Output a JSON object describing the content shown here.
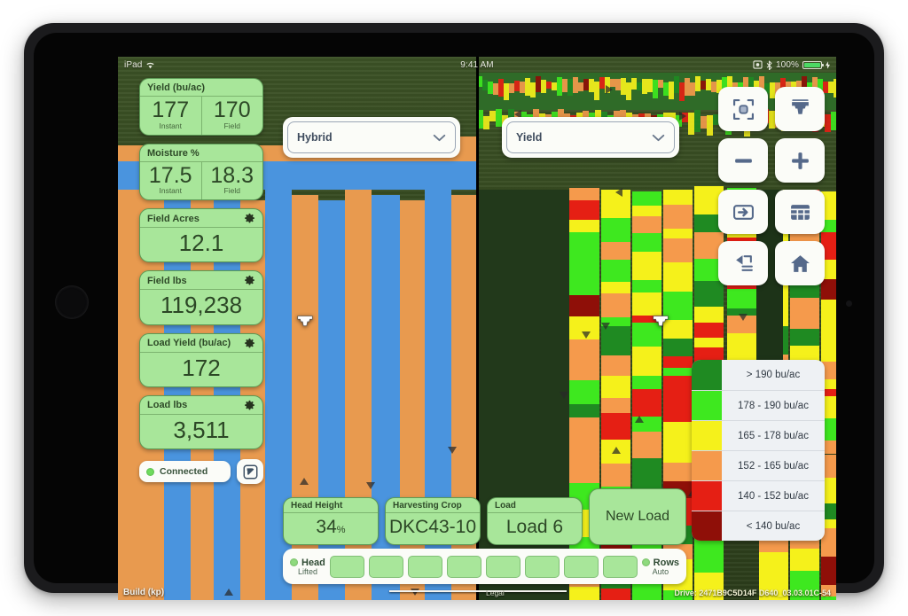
{
  "status_bar": {
    "carrier": "iPad",
    "wifi_icon": "wifi-icon",
    "time": "9:41 AM",
    "rotation_lock_icon": "rotation-lock-icon",
    "bluetooth_icon": "bluetooth-icon",
    "battery_percent": "100%",
    "battery_icon": "battery-charging-icon"
  },
  "metrics": [
    {
      "title": "Yield (bu/ac)",
      "has_gear": false,
      "type": "dual",
      "left_value": "177",
      "left_label": "Instant",
      "right_value": "170",
      "right_label": "Field"
    },
    {
      "title": "Moisture %",
      "has_gear": false,
      "type": "dual",
      "left_value": "17.5",
      "left_label": "Instant",
      "right_value": "18.3",
      "right_label": "Field"
    },
    {
      "title": "Field Acres",
      "has_gear": true,
      "type": "single",
      "value": "12.1"
    },
    {
      "title": "Field lbs",
      "has_gear": true,
      "type": "single",
      "value": "119,238"
    },
    {
      "title": "Load Yield (bu/ac)",
      "has_gear": true,
      "type": "single",
      "value": "172"
    },
    {
      "title": "Load lbs",
      "has_gear": true,
      "type": "single",
      "value": "3,511"
    }
  ],
  "connection": {
    "status_label": "Connected",
    "status_color": "#6fdb5e",
    "collapse_icon": "arrow-collapse-icon"
  },
  "dropdowns": {
    "left": {
      "name": "hybrid-dropdown",
      "value": "Hybrid",
      "chevron_icon": "chevron-down-icon"
    },
    "right": {
      "name": "yield-dropdown",
      "value": "Yield",
      "chevron_icon": "chevron-down-icon"
    }
  },
  "toolbar": [
    {
      "name": "center-map-button",
      "icon": "center-target-icon"
    },
    {
      "name": "machine-view-button",
      "icon": "combine-icon"
    },
    {
      "name": "zoom-out-button",
      "icon": "minus-icon"
    },
    {
      "name": "zoom-in-button",
      "icon": "plus-icon"
    },
    {
      "name": "split-view-button",
      "icon": "swap-pane-icon"
    },
    {
      "name": "data-table-button",
      "icon": "table-grid-icon"
    },
    {
      "name": "layers-back-button",
      "icon": "undo-list-icon"
    },
    {
      "name": "home-button",
      "icon": "home-icon"
    }
  ],
  "legend": {
    "units": "bu/ac",
    "rows": [
      {
        "color": "#1f8a22",
        "label": "> 190 bu/ac"
      },
      {
        "color": "#3ee81f",
        "label": "178 - 190 bu/ac"
      },
      {
        "color": "#f5f11b",
        "label": "165 - 178 bu/ac"
      },
      {
        "color": "#f59a4c",
        "label": "152 - 165 bu/ac"
      },
      {
        "color": "#e51f14",
        "label": "140 - 152 bu/ac"
      },
      {
        "color": "#8f0f08",
        "label": "< 140 bu/ac"
      }
    ]
  },
  "bottom_cards": [
    {
      "name": "head-height-card",
      "title": "Head Height",
      "value": "34",
      "suffix": "%"
    },
    {
      "name": "harvesting-crop-card",
      "title": "Harvesting Crop",
      "value": "DKC43-10",
      "suffix": ""
    },
    {
      "name": "load-card",
      "title": "Load",
      "value": "Load 6",
      "suffix": ""
    }
  ],
  "new_load_button": {
    "label": "New Load"
  },
  "row_bar": {
    "head_title": "Head",
    "head_state": "Lifted",
    "head_led_color": "#8fdb7e",
    "rows_title": "Rows",
    "rows_state": "Auto",
    "rows_led_color": "#8fdb7e",
    "segment_count": 8
  },
  "footer": {
    "build": "Build  (kp)",
    "legal": "Legal",
    "drive": "Drive: 2471B9C5D14F D640_03.03.01C-54"
  },
  "maps": {
    "left": {
      "name": "hybrid-map",
      "mode": "Hybrid"
    },
    "right": {
      "name": "yield-map",
      "mode": "Yield"
    }
  }
}
